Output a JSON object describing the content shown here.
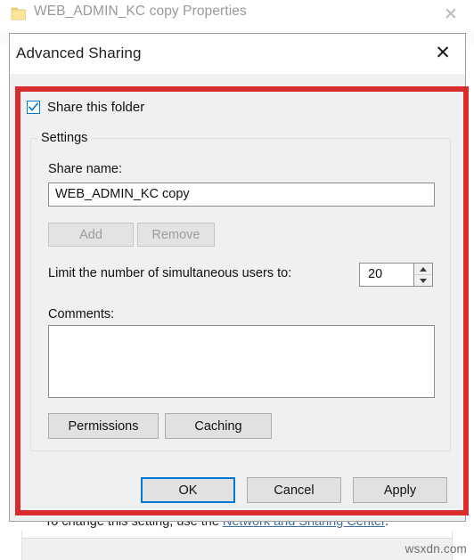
{
  "parent_window": {
    "title": "WEB_ADMIN_KC copy Properties",
    "folder_icon": "folder-icon",
    "close_icon": "✕",
    "hint_prefix": "To change this setting, use the ",
    "hint_link": "Network and Sharing Center",
    "hint_suffix": "."
  },
  "watermark": "wsxdn.com",
  "dialog": {
    "title": "Advanced Sharing",
    "close_icon": "✕",
    "share_this_folder": {
      "label": "Share this folder",
      "checked": true,
      "check_icon": "checkmark-icon"
    },
    "settings_group": {
      "title": "Settings",
      "share_name_label": "Share name:",
      "share_name_value": "WEB_ADMIN_KC copy",
      "share_name_placeholder": "Share name",
      "add_button": "Add",
      "remove_button": "Remove",
      "limit_label": "Limit the number of simultaneous users to:",
      "limit_value": "20",
      "spin_up_icon": "triangle-up-icon",
      "spin_down_icon": "triangle-down-icon",
      "comments_label": "Comments:",
      "comments_value": "",
      "comments_placeholder": "",
      "permissions_button": "Permissions",
      "caching_button": "Caching"
    },
    "footer": {
      "ok": "OK",
      "cancel": "Cancel",
      "apply": "Apply"
    }
  },
  "annotation": {
    "shape": "rectangle-highlight",
    "color": "#d82b2b"
  },
  "colors": {
    "dialog_bg": "#f0f0f0",
    "accent_blue": "#0078d7",
    "link_blue": "#3a6ea5",
    "annotation_red": "#d82b2b",
    "button_face": "#e1e1e1"
  }
}
